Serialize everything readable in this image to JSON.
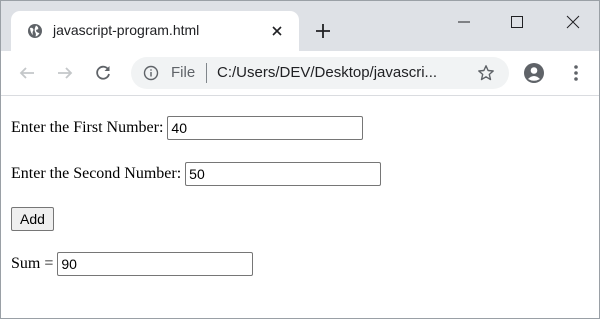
{
  "browser": {
    "tab_title": "javascript-program.html",
    "address_scheme_label": "File",
    "address_url": "C:/Users/DEV/Desktop/javascri...",
    "icons": {
      "tab": "globe-icon",
      "close": "close-icon",
      "new_tab": "plus-icon",
      "back": "back-arrow-icon",
      "forward": "forward-arrow-icon",
      "reload": "reload-icon",
      "info": "info-icon",
      "bookmark": "star-icon",
      "profile": "profile-icon",
      "menu": "kebab-menu-icon",
      "minimize": "minimize-icon",
      "maximize": "maximize-icon",
      "window_close": "window-close-icon"
    },
    "colors": {
      "tab_strip": "#dee1e6",
      "omnibox": "#f1f3f4",
      "icon": "#5f6368"
    }
  },
  "form": {
    "first_label": "Enter the First Number:",
    "first_value": "40",
    "second_label": "Enter the Second Number:",
    "second_value": "50",
    "add_button_label": "Add",
    "sum_label": "Sum =",
    "sum_value": "90"
  }
}
